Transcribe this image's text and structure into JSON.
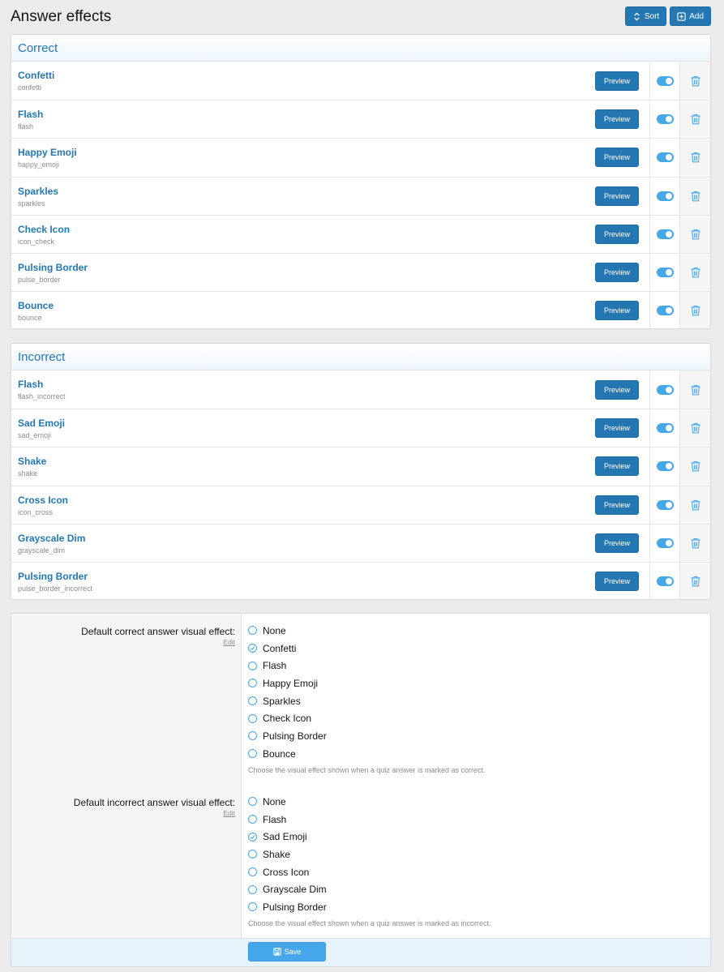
{
  "page": {
    "title": "Answer effects"
  },
  "header": {
    "sort_label": "Sort",
    "add_label": "Add"
  },
  "sections": [
    {
      "title": "Correct",
      "items": [
        {
          "title": "Confetti",
          "id": "confetti"
        },
        {
          "title": "Flash",
          "id": "flash"
        },
        {
          "title": "Happy Emoji",
          "id": "happy_emoji"
        },
        {
          "title": "Sparkles",
          "id": "sparkles"
        },
        {
          "title": "Check Icon",
          "id": "icon_check"
        },
        {
          "title": "Pulsing Border",
          "id": "pulse_border"
        },
        {
          "title": "Bounce",
          "id": "bounce"
        }
      ]
    },
    {
      "title": "Incorrect",
      "items": [
        {
          "title": "Flash",
          "id": "flash_incorrect"
        },
        {
          "title": "Sad Emoji",
          "id": "sad_emoji"
        },
        {
          "title": "Shake",
          "id": "shake"
        },
        {
          "title": "Cross Icon",
          "id": "icon_cross"
        },
        {
          "title": "Grayscale Dim",
          "id": "grayscale_dim"
        },
        {
          "title": "Pulsing Border",
          "id": "pulse_border_incorrect"
        }
      ]
    }
  ],
  "row_preview_label": "Preview",
  "options": {
    "correct": {
      "label": "Default correct answer visual effect:",
      "edit_label": "Edit",
      "choices": [
        "None",
        "Confetti",
        "Flash",
        "Happy Emoji",
        "Sparkles",
        "Check Icon",
        "Pulsing Border",
        "Bounce"
      ],
      "selected": "Confetti",
      "hint": "Choose the visual effect shown when a quiz answer is marked as correct."
    },
    "incorrect": {
      "label": "Default incorrect answer visual effect:",
      "edit_label": "Edit",
      "choices": [
        "None",
        "Flash",
        "Sad Emoji",
        "Shake",
        "Cross Icon",
        "Grayscale Dim",
        "Pulsing Border"
      ],
      "selected": "Sad Emoji",
      "hint": "Choose the visual effect shown when a quiz answer is marked as incorrect."
    }
  },
  "footer": {
    "save_label": "Save"
  },
  "colors": {
    "accent": "#2577b1",
    "toggle": "#47a7eb",
    "save": "#47a7eb"
  }
}
